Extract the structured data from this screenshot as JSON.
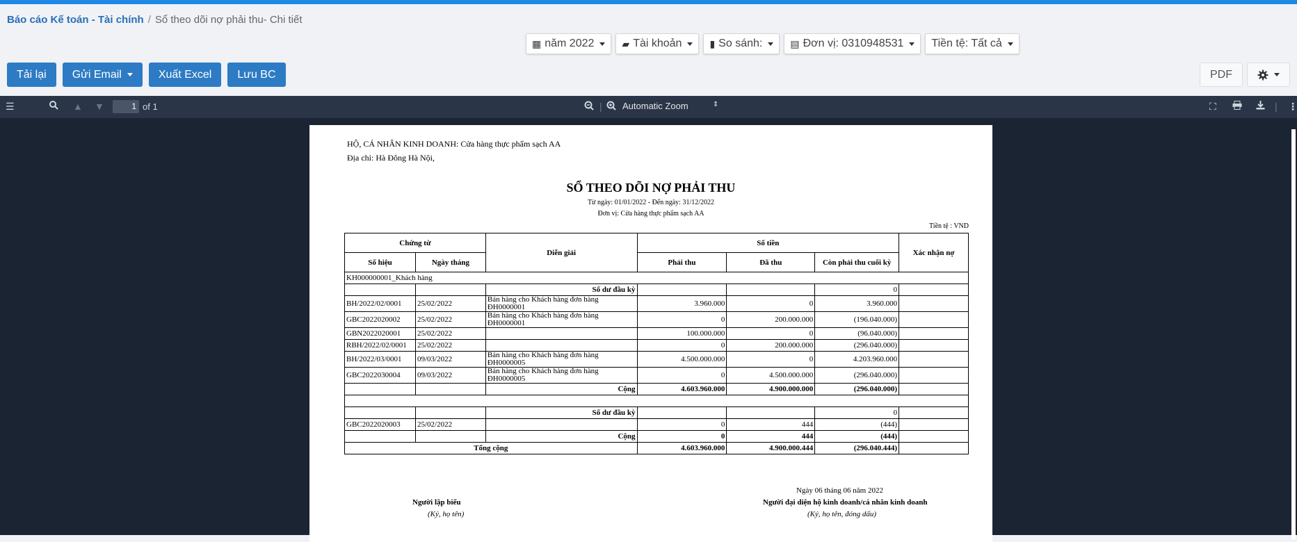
{
  "breadcrumb": {
    "root": "Báo cáo Kế toán - Tài chính",
    "sep": "/",
    "current": "Sổ theo dõi nợ phải thu- Chi tiết"
  },
  "filters": [
    {
      "icon": "calendar-icon",
      "glyph": "▦",
      "label": "năm 2022"
    },
    {
      "icon": "folder-icon",
      "glyph": "▰",
      "label": "Tài khoản"
    },
    {
      "icon": "bar-chart-icon",
      "glyph": "▮",
      "label": "So sánh:"
    },
    {
      "icon": "building-icon",
      "glyph": "▤",
      "label": "Đơn vị: 0310948531"
    },
    {
      "icon": "",
      "glyph": "",
      "label": "Tiền tệ: Tất cả"
    }
  ],
  "actions": {
    "reload": "Tải lại",
    "email": "Gửi Email",
    "excel": "Xuất Excel",
    "save": "Lưu BC",
    "pdf": "PDF"
  },
  "viewer": {
    "page_value": "1",
    "page_total": "of 1",
    "zoom": "Automatic Zoom"
  },
  "report": {
    "business": "HỘ, CÁ NHÂN KINH DOANH: Cửa hàng thực phẩm sạch AA",
    "address": "Địa chỉ: Hà Đông Hà Nội,",
    "title": "SỔ THEO DÕI NỢ PHẢI THU",
    "period": "Từ ngày: 01/01/2022 - Đến ngày: 31/12/2022",
    "unit": "Đơn vị: Cửa hàng thực phẩm sạch AA",
    "currency": "Tiền tệ : VND",
    "headers": {
      "voucher": "Chứng từ",
      "desc": "Diễn giải",
      "amount": "Số tiền",
      "confirm": "Xác nhận nợ",
      "no": "Số hiệu",
      "date": "Ngày tháng",
      "receivable": "Phải thu",
      "collected": "Đã thu",
      "remaining": "Còn phải thu cuối kỳ"
    },
    "group1": "KH000000001_Khách hàng",
    "opening_label": "Số dư đầu kỳ",
    "opening1": "0",
    "rows1": [
      {
        "no": "BH/2022/02/0001",
        "date": "25/02/2022",
        "desc": "Bán hàng cho Khách hàng đơn hàng ĐH0000001",
        "rec": "3.960.000",
        "col": "0",
        "rem": "3.960.000"
      },
      {
        "no": "GBC2022020002",
        "date": "25/02/2022",
        "desc": "Bán hàng cho Khách hàng đơn hàng ĐH0000001",
        "rec": "0",
        "col": "200.000.000",
        "rem": "(196.040.000)"
      },
      {
        "no": "GBN2022020001",
        "date": "25/02/2022",
        "desc": "",
        "rec": "100.000.000",
        "col": "0",
        "rem": "(96.040.000)"
      },
      {
        "no": "RBH/2022/02/0001",
        "date": "25/02/2022",
        "desc": "",
        "rec": "0",
        "col": "200.000.000",
        "rem": "(296.040.000)"
      },
      {
        "no": "BH/2022/03/0001",
        "date": "09/03/2022",
        "desc": "Bán hàng cho Khách hàng đơn hàng ĐH0000005",
        "rec": "4.500.000.000",
        "col": "0",
        "rem": "4.203.960.000"
      },
      {
        "no": "GBC2022030004",
        "date": "09/03/2022",
        "desc": "Bán hàng cho Khách hàng đơn hàng ĐH0000005",
        "rec": "0",
        "col": "4.500.000.000",
        "rem": "(296.040.000)"
      }
    ],
    "sum_label": "Cộng",
    "sum1": {
      "rec": "4.603.960.000",
      "col": "4.900.000.000",
      "rem": "(296.040.000)"
    },
    "opening2": "0",
    "rows2": [
      {
        "no": "GBC2022020003",
        "date": "25/02/2022",
        "desc": "",
        "rec": "0",
        "col": "444",
        "rem": "(444)"
      }
    ],
    "sum2": {
      "rec": "0",
      "col": "444",
      "rem": "(444)"
    },
    "total_label": "Tổng cộng",
    "total": {
      "rec": "4.603.960.000",
      "col": "4.900.000.444",
      "rem": "(296.040.444)"
    },
    "sign_date": "Ngày 06 tháng 06 năm 2022",
    "preparer": "Người lập biểu",
    "preparer_sub": "(Ký, họ tên)",
    "rep": "Người đại diện hộ kinh doanh/cá nhân kinh doanh",
    "rep_sub": "(Ký, họ tên, đóng dấu)"
  }
}
